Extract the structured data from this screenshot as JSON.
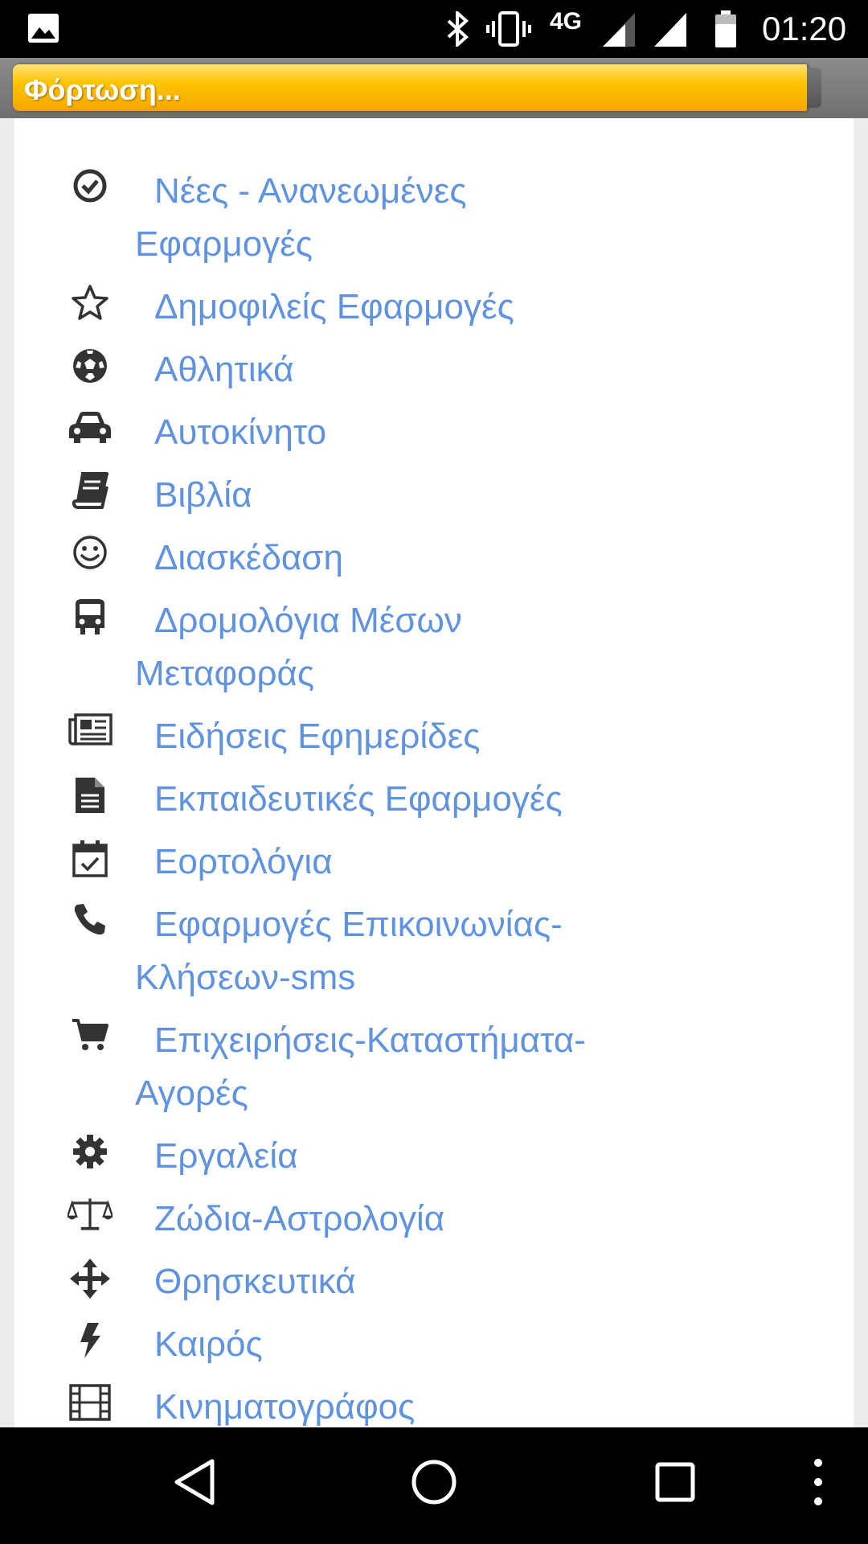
{
  "status_bar": {
    "network": "4G",
    "time": "01:20"
  },
  "loading": {
    "text": "Φόρτωση..."
  },
  "categories": [
    {
      "label": "Νέες - Ανανεωμένες Εφαρμογές",
      "icon": "check-circle-icon"
    },
    {
      "label": "Δημοφιλείς Εφαρμογές",
      "icon": "star-icon"
    },
    {
      "label": "Αθλητικά",
      "icon": "soccer-ball-icon"
    },
    {
      "label": "Αυτοκίνητο",
      "icon": "car-icon"
    },
    {
      "label": "Βιβλία",
      "icon": "book-icon"
    },
    {
      "label": "Διασκέδαση",
      "icon": "smiley-icon"
    },
    {
      "label": "Δρομολόγια Μέσων Μεταφοράς",
      "icon": "bus-icon"
    },
    {
      "label": "Ειδήσεις Εφημερίδες",
      "icon": "newspaper-icon"
    },
    {
      "label": "Εκπαιδευτικές Εφαρμογές",
      "icon": "document-icon"
    },
    {
      "label": "Εορτολόγια",
      "icon": "calendar-check-icon"
    },
    {
      "label": "Εφαρμογές Επικοινωνίας-Κλήσεων-sms",
      "icon": "phone-icon"
    },
    {
      "label": "Επιχειρήσεις-Καταστήματα-Αγορές",
      "icon": "cart-icon"
    },
    {
      "label": "Εργαλεία",
      "icon": "gear-icon"
    },
    {
      "label": "Ζώδια-Αστρολογία",
      "icon": "balance-scale-icon"
    },
    {
      "label": "Θρησκευτικά",
      "icon": "move-arrows-icon"
    },
    {
      "label": "Καιρός",
      "icon": "lightning-icon"
    },
    {
      "label": "Κινηματογράφος",
      "icon": "film-icon"
    }
  ],
  "colors": {
    "link": "#5f93e0",
    "loading_bar": "#ffc400",
    "icon": "#333333"
  }
}
